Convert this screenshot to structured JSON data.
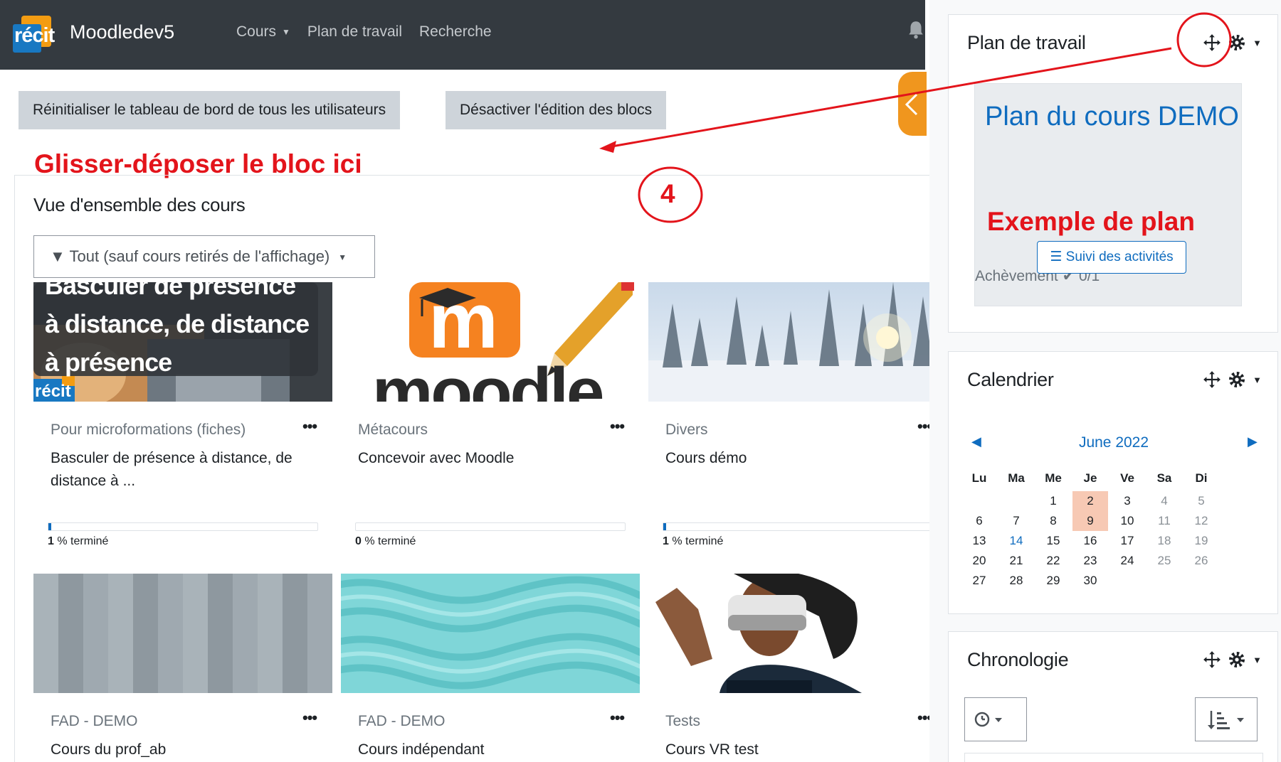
{
  "navbar": {
    "logo_text": "récit",
    "site_name": "Moodledev5",
    "links": [
      "Cours",
      "Plan de travail",
      "Recherche"
    ]
  },
  "toolbar": {
    "reset_label": "Réinitialiser le tableau de bord de tous les utilisateurs",
    "edit_label": "Désactiver l'édition des blocs"
  },
  "annotations": {
    "drop_here": "Glisser-déposer le bloc ici",
    "step_number": "4",
    "plan_example": "Exemple de plan"
  },
  "overview": {
    "title": "Vue d'ensemble des cours",
    "filter_label": "Tout (sauf cours retirés de l'affichage)",
    "courses": [
      {
        "category": "Pour microformations (fiches)",
        "name": "Basculer de présence à distance, de distance à ...",
        "progress": 1,
        "progress_suffix": "% terminé",
        "image_text": [
          "Basculer de présence",
          "à distance, de distance",
          "à présence"
        ],
        "image_logo": "récit"
      },
      {
        "category": "Métacours",
        "name": "Concevoir avec Moodle",
        "progress": 0,
        "progress_suffix": "% terminé",
        "image_text": "moodle"
      },
      {
        "category": "Divers",
        "name": "Cours démo",
        "progress": 1,
        "progress_suffix": "% terminé"
      },
      {
        "category": "FAD - DEMO",
        "name": "Cours du prof_ab"
      },
      {
        "category": "FAD - DEMO",
        "name": "Cours indépendant"
      },
      {
        "category": "Tests",
        "name": "Cours VR test"
      }
    ],
    "menu_glyph": "•••"
  },
  "blocks": {
    "plan": {
      "title": "Plan de travail",
      "course_name": "Plan du cours DEMO",
      "achievement_label": "Achèvement",
      "achievement_value": "0/1",
      "button_label": "Suivi des activités"
    },
    "calendar": {
      "title": "Calendrier",
      "month": "June 2022",
      "prev": "◀",
      "next": "▶",
      "weekdays": [
        "Lu",
        "Ma",
        "Me",
        "Je",
        "Ve",
        "Sa",
        "Di"
      ],
      "weeks": [
        [
          "",
          "",
          "1",
          "2",
          "3",
          "4",
          "5"
        ],
        [
          "6",
          "7",
          "8",
          "9",
          "10",
          "11",
          "12"
        ],
        [
          "13",
          "14",
          "15",
          "16",
          "17",
          "18",
          "19"
        ],
        [
          "20",
          "21",
          "22",
          "23",
          "24",
          "25",
          "26"
        ],
        [
          "27",
          "28",
          "29",
          "30",
          "",
          "",
          ""
        ]
      ],
      "highlighted": [
        "2",
        "9"
      ],
      "linked": [
        "14"
      ]
    },
    "timeline": {
      "title": "Chronologie"
    }
  },
  "colors": {
    "navbar": "#343a40",
    "primary": "#0f6cbf",
    "annotation": "#e3141b",
    "drawer": "#f0961e",
    "today": "#f7c9b4"
  }
}
